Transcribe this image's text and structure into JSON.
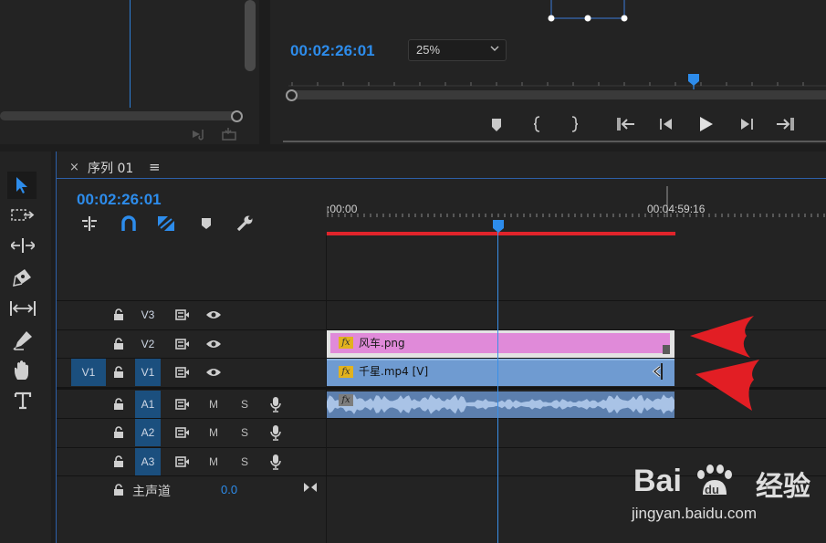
{
  "program": {
    "timecode": "00:02:26:01",
    "zoom_value": "25%"
  },
  "timeline": {
    "tab_title": "序列 01",
    "close_glyph": "×",
    "menu_glyph": "≡",
    "timecode": "00:02:26:01",
    "ruler": {
      "start": ":00:00",
      "end": "00:04:59:16"
    },
    "video_tracks": [
      {
        "source": "",
        "name": "V3"
      },
      {
        "source": "",
        "name": "V2"
      },
      {
        "source": "V1",
        "name": "V1"
      }
    ],
    "audio_tracks": [
      {
        "name": "A1",
        "m": "M",
        "s": "S"
      },
      {
        "name": "A2",
        "m": "M",
        "s": "S"
      },
      {
        "name": "A3",
        "m": "M",
        "s": "S"
      }
    ],
    "master": {
      "label": "主声道",
      "value": "0.0"
    },
    "clips": {
      "v2_name": "风车.png",
      "v1_name": "千星.mp4 [V]",
      "fx": "fx"
    }
  },
  "watermark": {
    "site": "jingyan.baidu.com",
    "brand_cn": "经验"
  },
  "colors": {
    "accent": "#2d8ceb",
    "v2_clip": "#e08ad9",
    "v1_clip": "#6f9bd1",
    "arrow": "#e21e24",
    "render_bar": "#e0242b"
  }
}
